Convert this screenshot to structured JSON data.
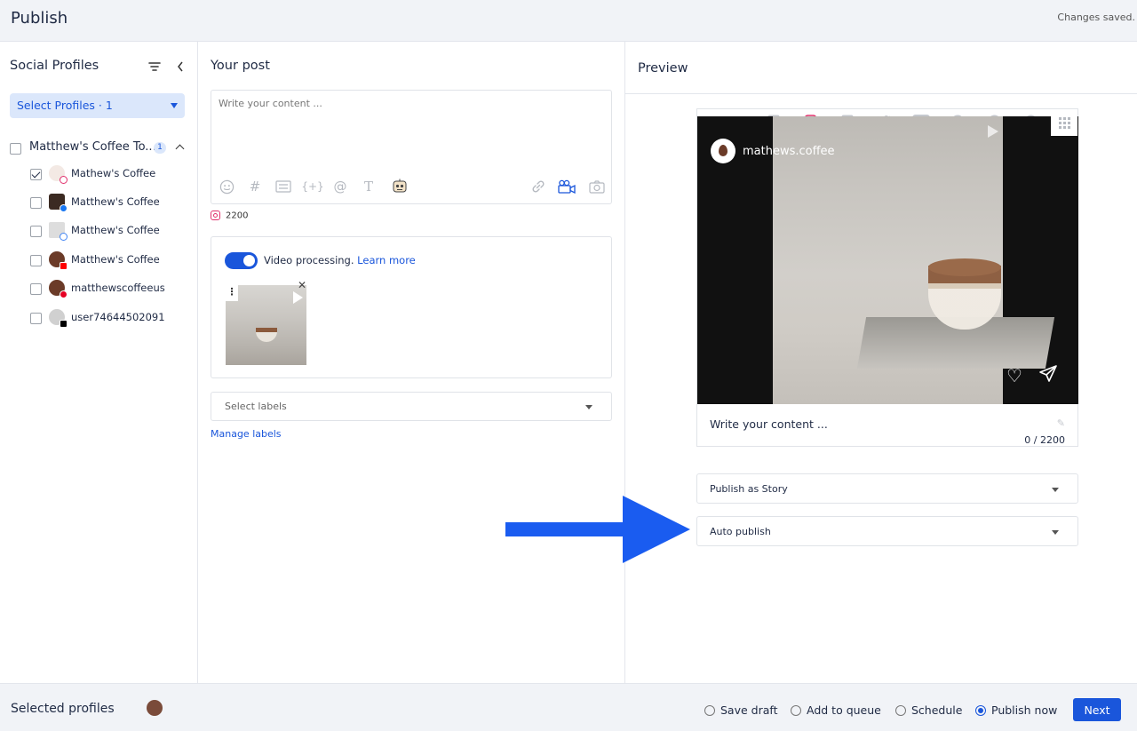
{
  "header": {
    "title": "Publish",
    "status": "Changes saved."
  },
  "sidebar": {
    "title": "Social Profiles",
    "select_label": "Select Profiles · 1",
    "group": {
      "label": "Matthew's Coffee To...",
      "count": "1"
    },
    "profiles": [
      {
        "name": "Mathew's Coffee",
        "checked": true,
        "network": "instagram"
      },
      {
        "name": "Matthew's Coffee",
        "checked": false,
        "network": "facebook"
      },
      {
        "name": "Matthew's Coffee",
        "checked": false,
        "network": "google"
      },
      {
        "name": "Matthew's Coffee",
        "checked": false,
        "network": "youtube"
      },
      {
        "name": "matthewscoffeeus",
        "checked": false,
        "network": "pinterest"
      },
      {
        "name": "user74644502091",
        "checked": false,
        "network": "tiktok"
      }
    ]
  },
  "post": {
    "title": "Your post",
    "placeholder": "Write your content ...",
    "char_limit": "2200",
    "video_processing_label": "Video processing.",
    "learn_more": "Learn more",
    "labels_placeholder": "Select labels",
    "manage_labels": "Manage labels"
  },
  "preview": {
    "title": "Preview",
    "active_network": "instagram",
    "networks": [
      "facebook-icon",
      "instagram-icon",
      "linkedin-icon",
      "twitter-icon",
      "youtube-icon",
      "google-icon",
      "reddit-icon",
      "pinterest-icon",
      "tiktok-icon"
    ],
    "handle": "mathews.coffee",
    "content": "Write your content ...",
    "count": "0 / 2200",
    "publish_as": "Publish as Story",
    "publish_mode": "Auto publish"
  },
  "footer": {
    "selected_profiles": "Selected profiles",
    "options": [
      {
        "label": "Save draft",
        "selected": false
      },
      {
        "label": "Add to queue",
        "selected": false
      },
      {
        "label": "Schedule",
        "selected": false
      },
      {
        "label": "Publish now",
        "selected": true
      }
    ],
    "next": "Next"
  },
  "colors": {
    "accent": "#1a56db",
    "arrow": "#1a5cf0",
    "header_bg": "#f1f3f7"
  }
}
